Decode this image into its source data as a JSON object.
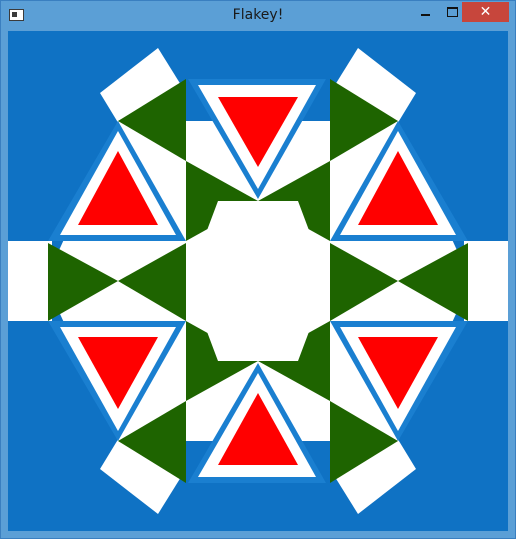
{
  "window": {
    "title": "Flakey!",
    "controls": {
      "minimize": "minimize",
      "maximize": "maximize",
      "close": "✕"
    }
  },
  "colors": {
    "background": "#0f72c4",
    "white": "#ffffff",
    "green": "#1e6400",
    "red": "#ff0000",
    "outline_blue": "#1a7fd0"
  },
  "icons": [
    "app-icon",
    "minimize-icon",
    "maximize-icon",
    "close-icon"
  ]
}
